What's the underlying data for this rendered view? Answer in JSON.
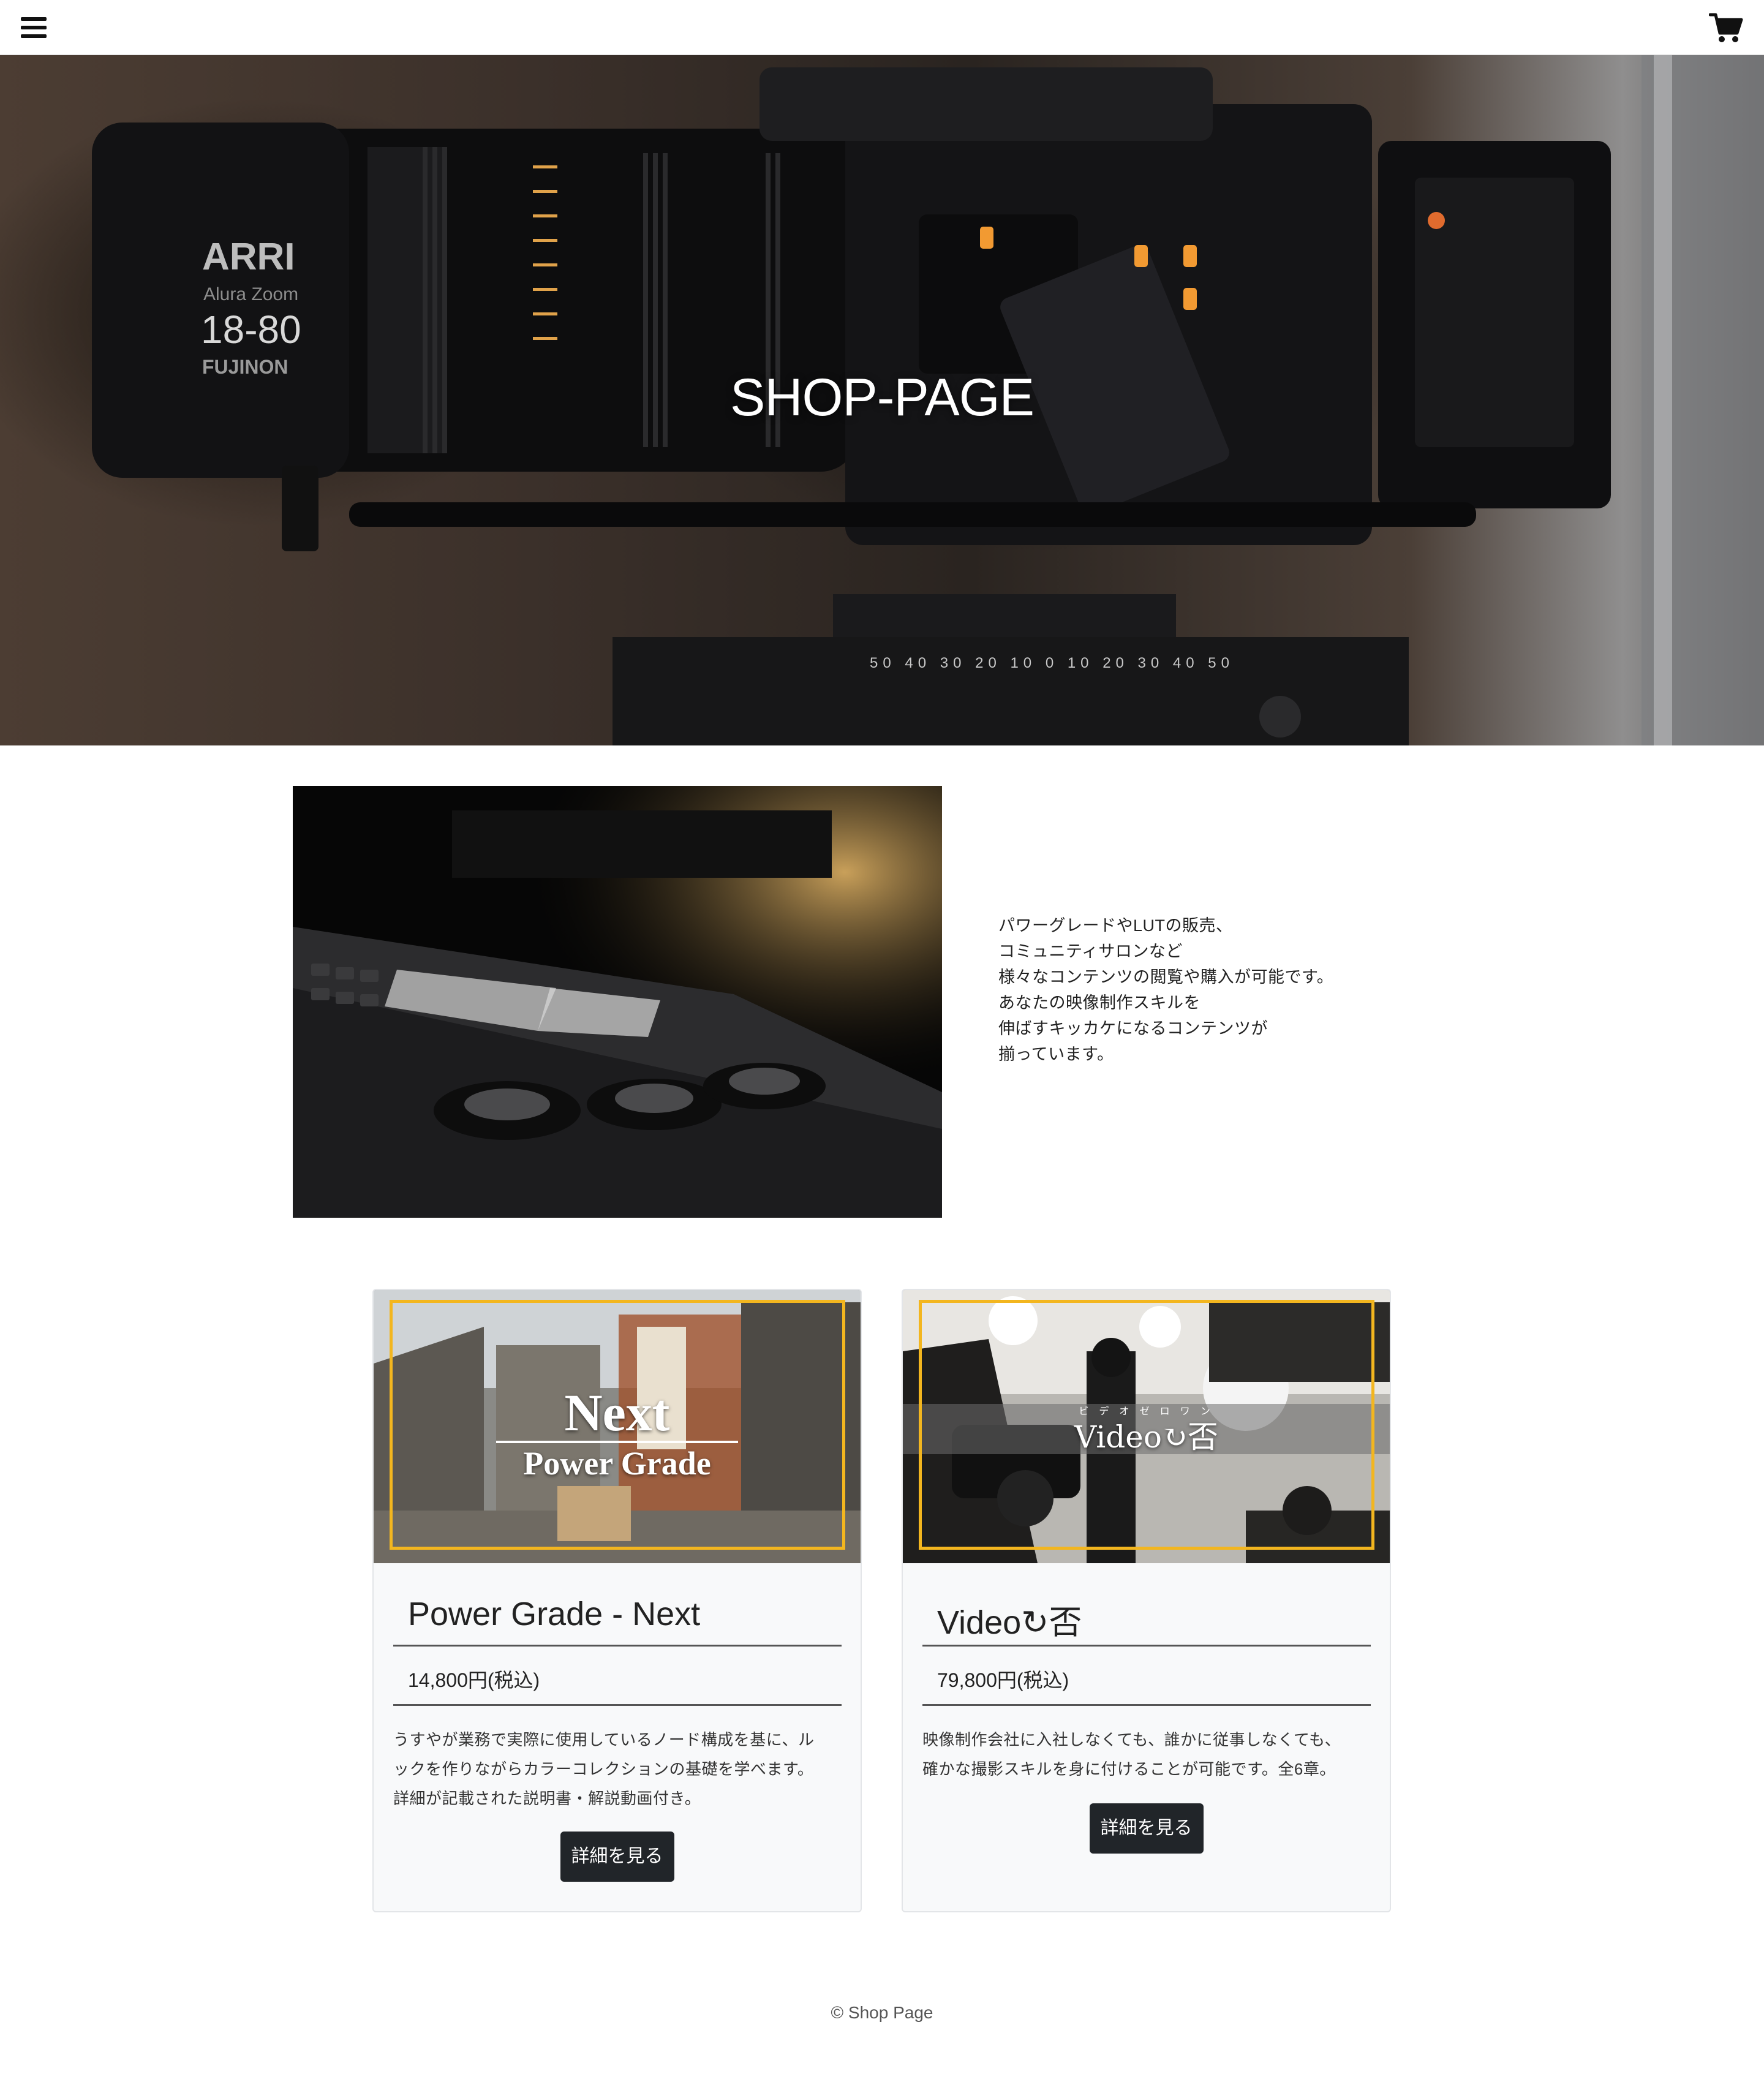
{
  "header": {
    "menu_icon": "hamburger-menu-icon",
    "cart_icon": "shopping-cart-icon"
  },
  "hero": {
    "title": "SHOP-PAGE",
    "lens_brand": "ARRI",
    "lens_model": "Alura Zoom",
    "lens_focal": "18-80",
    "lens_maker": "FUJINON"
  },
  "about": {
    "lines": [
      "パワーグレードやLUTの販売、",
      "コミュニティサロンなど",
      "様々なコンテンツの閲覧や購入が可能です。",
      "あなたの映像制作スキルを",
      "伸ばすキッカケになるコンテンツが",
      "揃っています。"
    ]
  },
  "products": [
    {
      "thumb_title": "Next",
      "thumb_subtitle": "Power Grade",
      "title": "Power Grade - Next",
      "price": "14,800円(税込)",
      "description": [
        "うすやが業務で実際に使用しているノード構成を基に、ル",
        "ックを作りながらカラーコレクションの基礎を学べます。",
        "詳細が記載された説明書・解説動画付き。"
      ],
      "button_label": "詳細を見る"
    },
    {
      "thumb_title": "Video↻否",
      "thumb_ruby": "ビ デ オ ゼ ロ ワ ン",
      "title": "Video↻否",
      "price": "79,800円(税込)",
      "description": [
        "映像制作会社に入社しなくても、誰かに従事しなくても、",
        "確かな撮影スキルを身に付けることが可能です。全6章。"
      ],
      "button_label": "詳細を見る"
    }
  ],
  "footer": {
    "copyright": "© Shop Page"
  },
  "colors": {
    "accent_frame": "#f3b61f",
    "button": "#212529",
    "card_bg": "#f8f9fa"
  }
}
